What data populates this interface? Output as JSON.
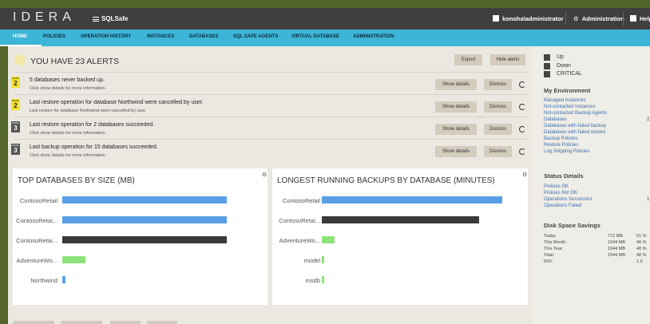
{
  "header": {
    "logo": "IDERA",
    "product": "SQLSafe",
    "user": "konoha\\administrator",
    "admin": "Administration",
    "help": "Help"
  },
  "nav": [
    "HOME",
    "POLICIES",
    "OPERATION HISTORY",
    "INSTANCES",
    "DATABASES",
    "SQL SAFE AGENTS",
    "VIRTUAL DATABASE",
    "ADMINISTRATION"
  ],
  "alerts": {
    "title": "YOU HAVE 23 ALERTS",
    "export_label": "Export",
    "hide_label": "Hide alerts",
    "show_details_label": "Show details",
    "dismiss_label": "Dismiss",
    "level_tag": "LEVEL",
    "items": [
      {
        "level": "2",
        "text": "5 databases never backed up.",
        "sub": "Click show details for more information.",
        "color": "#f5e22c"
      },
      {
        "level": "2",
        "text": "Last restore operation for database Northwind were cancelled by user.",
        "sub": "Last restore for database Northwind were cancelled by user.",
        "color": "#f5e22c"
      },
      {
        "level": "3",
        "text": "Last restore operation for 2 databases succeeded.",
        "sub": "Click show details for more information.",
        "color": "#555555"
      },
      {
        "level": "3",
        "text": "Last backup operation for 15 databases succeeded.",
        "sub": "Click show details for more information.",
        "color": "#555555"
      }
    ]
  },
  "chart_data": [
    {
      "type": "bar",
      "title": "TOP DATABASES BY SIZE (MB)",
      "categories": [
        "ContosoRetail",
        "ContosoRetai...",
        "ContosoRetai...",
        "AdventureWo...",
        "Northwind"
      ],
      "values": [
        100,
        100,
        100,
        14,
        2
      ],
      "colors": [
        "#5aa0e6",
        "#5aa0e6",
        "#3a3a3a",
        "#8ee27a",
        "#5aa0e6"
      ]
    },
    {
      "type": "bar",
      "title": "LONGEST RUNNING BACKUPS BY DATABASE (MINUTES)",
      "categories": [
        "ContosoRetail",
        "ContosoRetai...",
        "AdventureWo...",
        "model",
        "msdb"
      ],
      "values": [
        100,
        87,
        7,
        1,
        1
      ],
      "colors": [
        "#5aa0e6",
        "#3a3a3a",
        "#8ee27a",
        "#8ee27a",
        "#8ee27a"
      ]
    }
  ],
  "sidebar": {
    "legend": [
      "Up",
      "Down",
      "CRITICAL"
    ],
    "my_env_title": "My Environment",
    "env_links": [
      {
        "label": "Managed Instances",
        "value": ""
      },
      {
        "label": "Not-contacted Instances",
        "value": ""
      },
      {
        "label": "Not-contacted Backup Agents",
        "value": ""
      },
      {
        "label": "Databases",
        "value": "2"
      },
      {
        "label": "Databases with failed backup",
        "value": ""
      },
      {
        "label": "Databases with failed restore",
        "value": ""
      },
      {
        "label": "Backup Policies",
        "value": ""
      },
      {
        "label": "Restore Policies",
        "value": ""
      },
      {
        "label": "Log Shipping Policies",
        "value": ""
      }
    ],
    "status_title": "Status Details",
    "status": [
      {
        "label": "Policies OK",
        "value": "",
        "color": "#3aa63a"
      },
      {
        "label": "Policies Not OK",
        "value": "",
        "color": "#e5a11c"
      },
      {
        "label": "Operations Successful",
        "value": "1",
        "color": "#3aa63a"
      },
      {
        "label": "Operations Failed",
        "value": "",
        "color": "#e5a11c"
      }
    ],
    "disk_title": "Disk Space Savings",
    "disk": [
      {
        "label": "Today:",
        "mb": "772 MB",
        "pct": "51 %"
      },
      {
        "label": "This Month:",
        "mb": "1944 MB",
        "pct": "48 %"
      },
      {
        "label": "This Year:",
        "mb": "1944 MB",
        "pct": "48 %"
      },
      {
        "label": "Total:",
        "mb": "1944 MB",
        "pct": "48 %"
      },
      {
        "label": "ROI:",
        "mb": "",
        "pct": "1.9"
      }
    ]
  }
}
